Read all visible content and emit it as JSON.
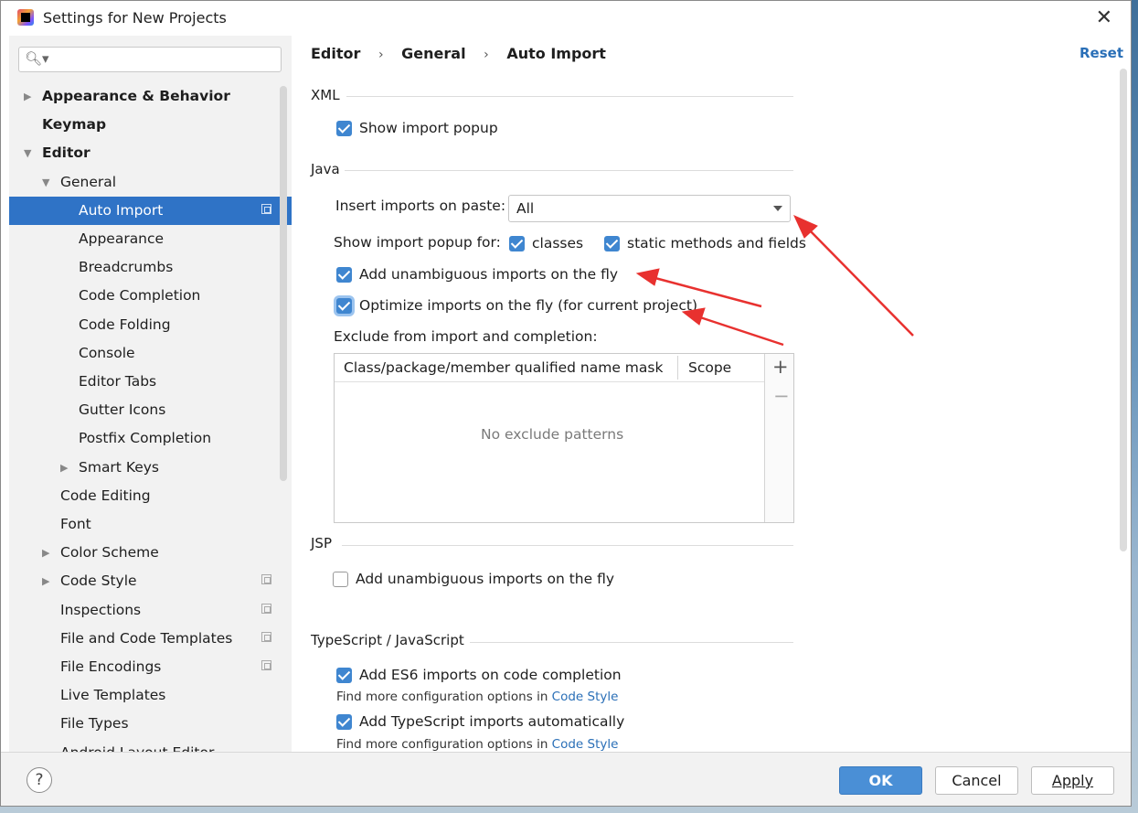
{
  "window": {
    "title": "Settings for New Projects",
    "close_glyph": "✕"
  },
  "search": {
    "glyph": "🔍︎▾"
  },
  "tree": [
    {
      "label": "Appearance & Behavior",
      "bold": true,
      "arrow": "▶"
    },
    {
      "label": "Keymap",
      "bold": true,
      "arrow": ""
    },
    {
      "label": "Editor",
      "bold": true,
      "arrow": "▼"
    },
    {
      "label": "General",
      "arrow": "▼"
    },
    {
      "label": "Auto Import",
      "selected": true
    },
    {
      "label": "Appearance"
    },
    {
      "label": "Breadcrumbs"
    },
    {
      "label": "Code Completion"
    },
    {
      "label": "Code Folding"
    },
    {
      "label": "Console"
    },
    {
      "label": "Editor Tabs"
    },
    {
      "label": "Gutter Icons"
    },
    {
      "label": "Postfix Completion"
    },
    {
      "label": "Smart Keys",
      "arrow": "▶"
    },
    {
      "label": "Code Editing"
    },
    {
      "label": "Font"
    },
    {
      "label": "Color Scheme",
      "arrow": "▶"
    },
    {
      "label": "Code Style",
      "arrow": "▶"
    },
    {
      "label": "Inspections"
    },
    {
      "label": "File and Code Templates"
    },
    {
      "label": "File Encodings"
    },
    {
      "label": "Live Templates"
    },
    {
      "label": "File Types"
    },
    {
      "label": "Android Layout Editor"
    }
  ],
  "breadcrumb": {
    "items": [
      "Editor",
      "General",
      "Auto Import"
    ],
    "separator": "›"
  },
  "reset_label": "Reset",
  "xml": {
    "title": "XML",
    "show_popup": "Show import popup"
  },
  "java": {
    "title": "Java",
    "insert_label": "Insert imports on paste:",
    "insert_value": "All",
    "popup_label": "Show import popup for:",
    "classes": "classes",
    "static_methods": "static methods and fields",
    "add_unambiguous": "Add unambiguous imports on the fly",
    "optimize": "Optimize imports on the fly (for current project)",
    "exclude_label": "Exclude from import and completion:",
    "table": {
      "col1": "Class/package/member qualified name mask",
      "col2": "Scope",
      "empty": "No exclude patterns",
      "add": "+",
      "remove": "−"
    }
  },
  "jsp": {
    "title": "JSP",
    "add_unambiguous": "Add unambiguous imports on the fly"
  },
  "ts": {
    "title": "TypeScript / JavaScript",
    "es6": "Add ES6 imports on code completion",
    "hint_prefix": "Find more configuration options in",
    "hint_link": "Code Style",
    "ts_auto": "Add TypeScript imports automatically"
  },
  "footer": {
    "help": "?",
    "ok": "OK",
    "cancel": "Cancel",
    "apply": "Apply"
  },
  "colors": {
    "accent": "#2f73c6",
    "checkbox": "#3f86d0",
    "annotation": "#e8312f"
  }
}
